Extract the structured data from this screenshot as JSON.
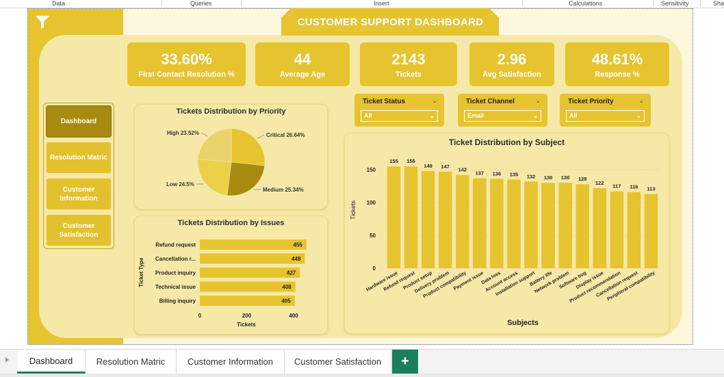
{
  "ribbon": [
    "Data",
    "Queries",
    "Insert",
    "Calculations",
    "Sensitivity",
    "Sha"
  ],
  "dashboard_title": "CUSTOMER SUPPORT DASHBOARD",
  "kpis": [
    {
      "value": "33.60%",
      "label": "First Contact Resolution %"
    },
    {
      "value": "44",
      "label": "Average Age"
    },
    {
      "value": "2143",
      "label": "Tickets"
    },
    {
      "value": "2.96",
      "label": "Avg Satisfaction"
    },
    {
      "value": "48.61%",
      "label": "Response %"
    }
  ],
  "nav": [
    {
      "label": "Dashboard",
      "active": true
    },
    {
      "label": "Resolution Matric",
      "active": false
    },
    {
      "label": "Customer Information",
      "active": false
    },
    {
      "label": "Customer Satisfaction",
      "active": false
    }
  ],
  "slicers": [
    {
      "label": "Ticket Status",
      "value": "All"
    },
    {
      "label": "Ticket Channel",
      "value": "Email"
    },
    {
      "label": "Ticket Priority",
      "value": "All"
    }
  ],
  "tabs": [
    {
      "label": "Dashboard",
      "active": true
    },
    {
      "label": "Resolution Matric",
      "active": false
    },
    {
      "label": "Customer Information",
      "active": false
    },
    {
      "label": "Customer Satisfaction",
      "active": false
    }
  ],
  "add_tab_label": "+",
  "colors": {
    "accent": "#e6c42f",
    "dark": "#a88a10",
    "panel": "#f6e9a8",
    "tab_green": "#1b7f5e"
  },
  "icons": {
    "filter": "filter-icon",
    "chevron": "chevron-down-icon",
    "add": "plus-icon"
  },
  "chart_data": [
    {
      "type": "pie",
      "title": "Tickets Distribution by Priority",
      "slices": [
        {
          "name": "Critical",
          "label": "Critical 26.64%",
          "value": 26.64,
          "color": "#e6c42f"
        },
        {
          "name": "Medium",
          "label": "Medium 25.34%",
          "value": 25.34,
          "color": "#a88a10"
        },
        {
          "name": "Low",
          "label": "Low 24.5%",
          "value": 24.5,
          "color": "#edd04a"
        },
        {
          "name": "High",
          "label": "High 23.52%",
          "value": 23.52,
          "color": "#ebd36b"
        }
      ]
    },
    {
      "type": "bar",
      "orientation": "horizontal",
      "title": "Tickets Distribution by Issues",
      "categories": [
        "Refund request",
        "Cancellation r...",
        "Product inquiry",
        "Technical issue",
        "Billing inquiry"
      ],
      "values": [
        455,
        448,
        427,
        408,
        405
      ],
      "xlabel": "Tickets",
      "ylabel": "Ticket Type",
      "xticks": [
        0,
        200,
        400
      ],
      "xlim": [
        0,
        470
      ]
    },
    {
      "type": "bar",
      "title": "Ticket Distribution by Subject",
      "categories": [
        "Hardware issue",
        "Refund request",
        "Product setup",
        "Delivery problem",
        "Product compatibility",
        "Payment issue",
        "Data loss",
        "Account access",
        "Installation support",
        "Battery life",
        "Network problem",
        "Software bug",
        "Display issue",
        "Product recommendation",
        "Cancellation request",
        "Peripheral compatibility"
      ],
      "values": [
        155,
        155,
        148,
        147,
        142,
        137,
        136,
        135,
        132,
        130,
        130,
        128,
        122,
        117,
        116,
        113
      ],
      "xlabel": "Subjects",
      "ylabel": "Tickets",
      "yticks": [
        0,
        50,
        100,
        150
      ],
      "ylim": [
        0,
        160
      ],
      "grid": true
    }
  ]
}
